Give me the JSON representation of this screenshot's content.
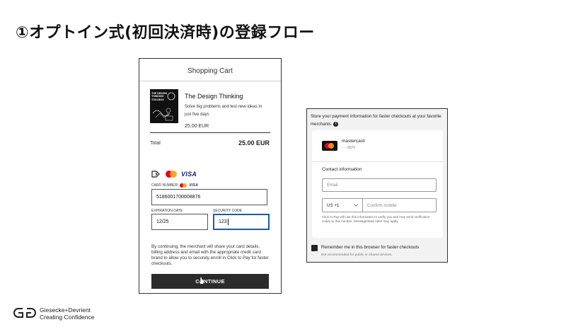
{
  "slide": {
    "title": "①オプトイン式(初回決済時)の登録フロー"
  },
  "cart": {
    "title": "Shopping Cart",
    "product": {
      "cover_text": "THE DESIGN THINKING TOOLBOX",
      "name": "The Design Thinking",
      "description": "Solve big problems and test new ideas in just five days",
      "price": "25.00 EUR"
    },
    "total_label": "Total",
    "total_value": "25.00 EUR",
    "brands": {
      "click_to_pay_icon": "click-to-pay-icon",
      "mastercard_icon": "mastercard-icon",
      "visa_label": "VISA"
    },
    "card_number_label": "CARD NUMBER",
    "card_number_value": "5186001700008876",
    "expiration_label": "EXPIRATION DATE",
    "expiration_value": "12/25",
    "security_label": "SECURITY CODE",
    "security_value": "123",
    "consent": "By continuing, the merchant will share your card details, billing address and email with the appropriate credit card brand to allow you to securely enroll in Click to Pay for faster checkouts.",
    "continue_label": "CONTINUE"
  },
  "click_to_pay": {
    "header": "Store your payment information for faster checkouts at your favorite merchants.",
    "info_icon": "i",
    "card_brand": "mastercard",
    "card_masked": "···· 8876",
    "contact_heading": "Contact information",
    "email_placeholder": "Email",
    "country_code": "US +1",
    "mobile_placeholder": "Confirm mobile",
    "note": "Click to Pay will use this information to verify you and may send verification codes to this number. Message/data rates may apply.",
    "remember_label": "Remember me in this browser for faster checkouts",
    "remember_sub": "Not recommended for public or shared devices.",
    "remember_checked": true
  },
  "footer": {
    "company": "Giesecke+Devrient",
    "tagline": "Creating Confidence"
  },
  "colors": {
    "mastercard_red": "#eb001b",
    "mastercard_yellow": "#f79e1b",
    "visa_blue": "#1a1f71",
    "focus_blue": "#1e5aa8",
    "button_dark": "#2b2b2b"
  }
}
